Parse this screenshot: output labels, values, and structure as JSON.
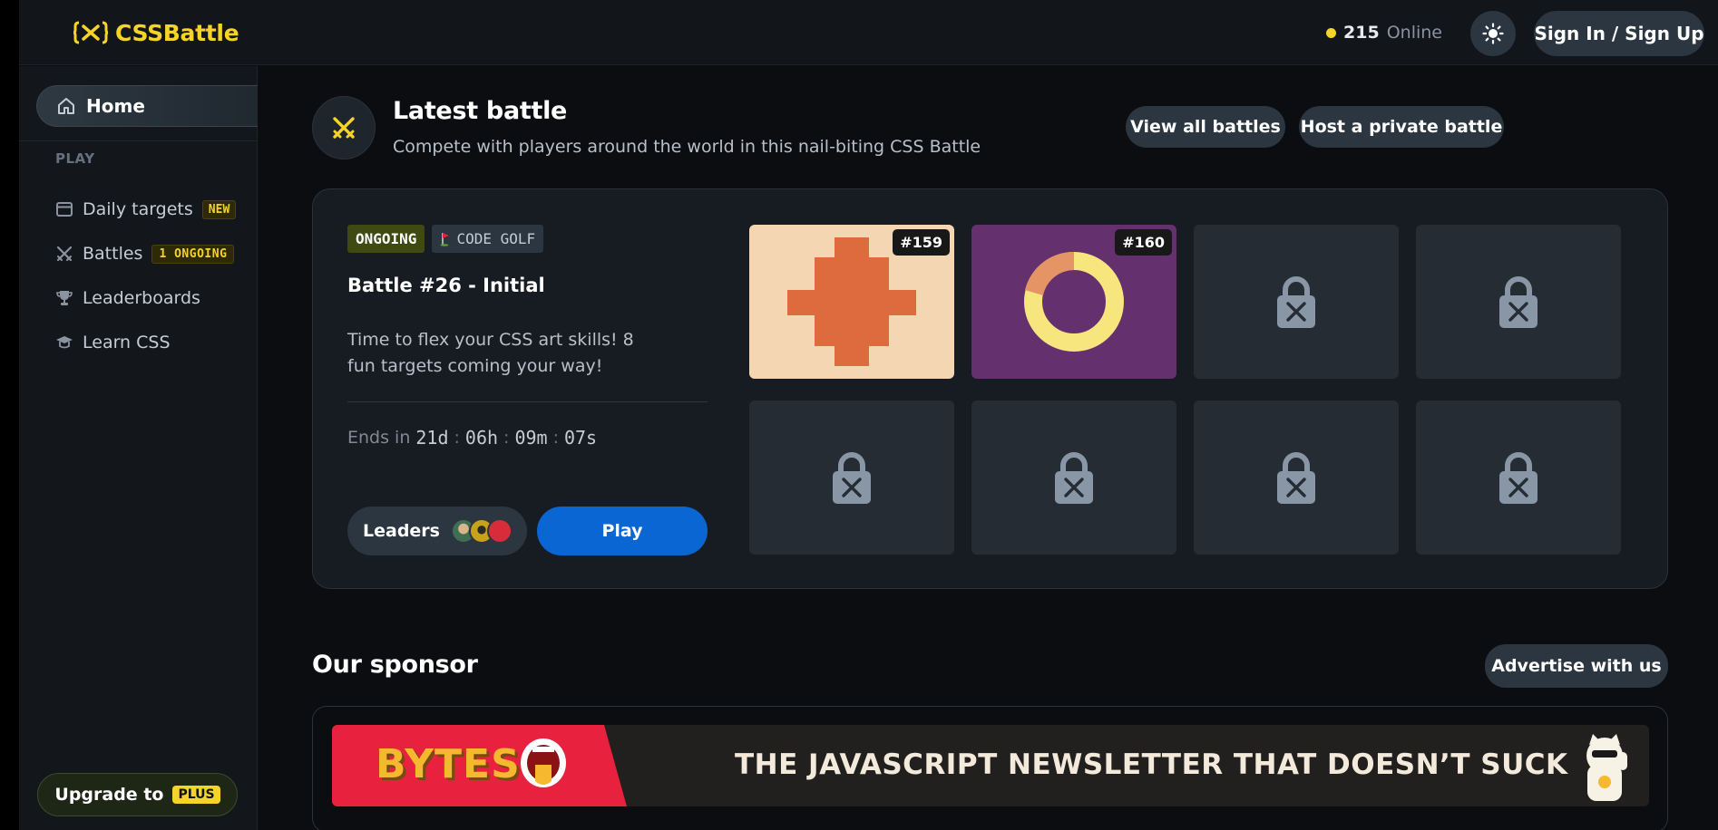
{
  "header": {
    "logo_text": "CSSBattle",
    "online_count": "215",
    "online_label": "Online",
    "auth_button": "Sign In / Sign Up"
  },
  "sidebar": {
    "home_label": "Home",
    "section_play": "PLAY",
    "items": [
      {
        "label": "Daily targets",
        "badge": "NEW",
        "icon": "calendar-icon"
      },
      {
        "label": "Battles",
        "badge": "1 ONGOING",
        "icon": "swords-icon"
      },
      {
        "label": "Leaderboards",
        "icon": "trophy-icon"
      },
      {
        "label": "Learn CSS",
        "icon": "graduation-cap-icon"
      }
    ],
    "upgrade_label": "Upgrade to",
    "upgrade_badge": "PLUS"
  },
  "latest_battle": {
    "title": "Latest battle",
    "subtitle": "Compete with players around the world in this nail-biting CSS Battle",
    "view_all_button": "View all battles",
    "host_button": "Host a private battle",
    "tag_status": "ONGOING",
    "tag_mode": "CODE GOLF",
    "battle_name": "Battle #26 - Initial",
    "description": "Time to flex your CSS art skills! 8 fun targets coming your way!",
    "ends_label": "Ends in",
    "countdown": {
      "days": "21d",
      "hours": "06h",
      "minutes": "09m",
      "seconds": "07s"
    },
    "separator": ":",
    "leaders_button": "Leaders",
    "play_button": "Play",
    "targets": [
      {
        "number": "#159",
        "locked": false,
        "bg": "#f5d6b2",
        "fg": "#dd6b3e"
      },
      {
        "number": "#160",
        "locked": false,
        "bg": "#65306e",
        "fg": "#f7e67e",
        "accent": "#e59465"
      },
      {
        "locked": true
      },
      {
        "locked": true
      },
      {
        "locked": true
      },
      {
        "locked": true
      },
      {
        "locked": true
      },
      {
        "locked": true
      }
    ]
  },
  "sponsor": {
    "title": "Our sponsor",
    "advertise_button": "Advertise with us",
    "banner_brand": "BYTES",
    "banner_text": "THE JAVASCRIPT NEWSLETTER THAT DOESN’T SUCK"
  },
  "colors": {
    "accent_yellow": "#f5d327",
    "play_blue": "#0a66d2",
    "button_bg": "#2b3640"
  }
}
